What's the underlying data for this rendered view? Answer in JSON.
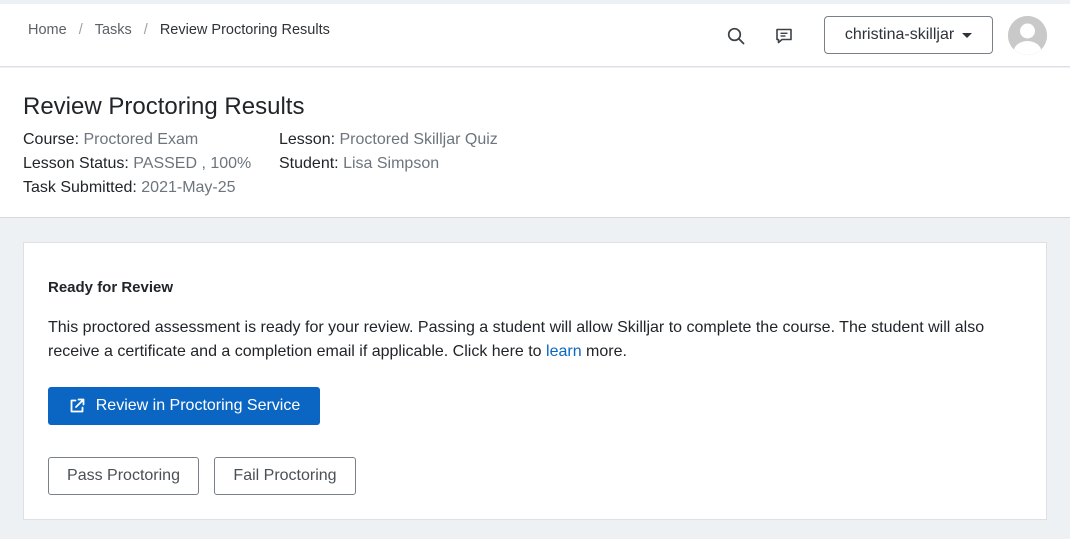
{
  "breadcrumb": {
    "home": "Home",
    "tasks": "Tasks",
    "current": "Review Proctoring Results",
    "separator": "/"
  },
  "topbar": {
    "search_icon": "search-icon",
    "chat_icon": "message-icon",
    "user_label": "christina-skilljar"
  },
  "header": {
    "title": "Review Proctoring Results",
    "course_key": "Course:",
    "course_value": "Proctored Exam",
    "status_key": "Lesson Status:",
    "status_value": "PASSED , 100%",
    "submitted_key": "Task Submitted:",
    "submitted_value": "2021-May-25",
    "lesson_key": "Lesson:",
    "lesson_value": "Proctored Skilljar Quiz",
    "student_key": "Student:",
    "student_value": "Lisa Simpson"
  },
  "card": {
    "title": "Ready for Review",
    "text_before": "This proctored assessment is ready for your review. Passing a student will allow Skilljar to complete the course. The student will also receive a certificate and a completion email if applicable. Click here to ",
    "link": "learn",
    "text_after": " more.",
    "review_button": "Review in Proctoring Service",
    "pass_button": "Pass Proctoring",
    "fail_button": "Fail Proctoring"
  },
  "colors": {
    "primary": "#0a66c2",
    "link": "#0a66c2",
    "muted": "#6c757d",
    "page_bg": "#eef1f4"
  }
}
